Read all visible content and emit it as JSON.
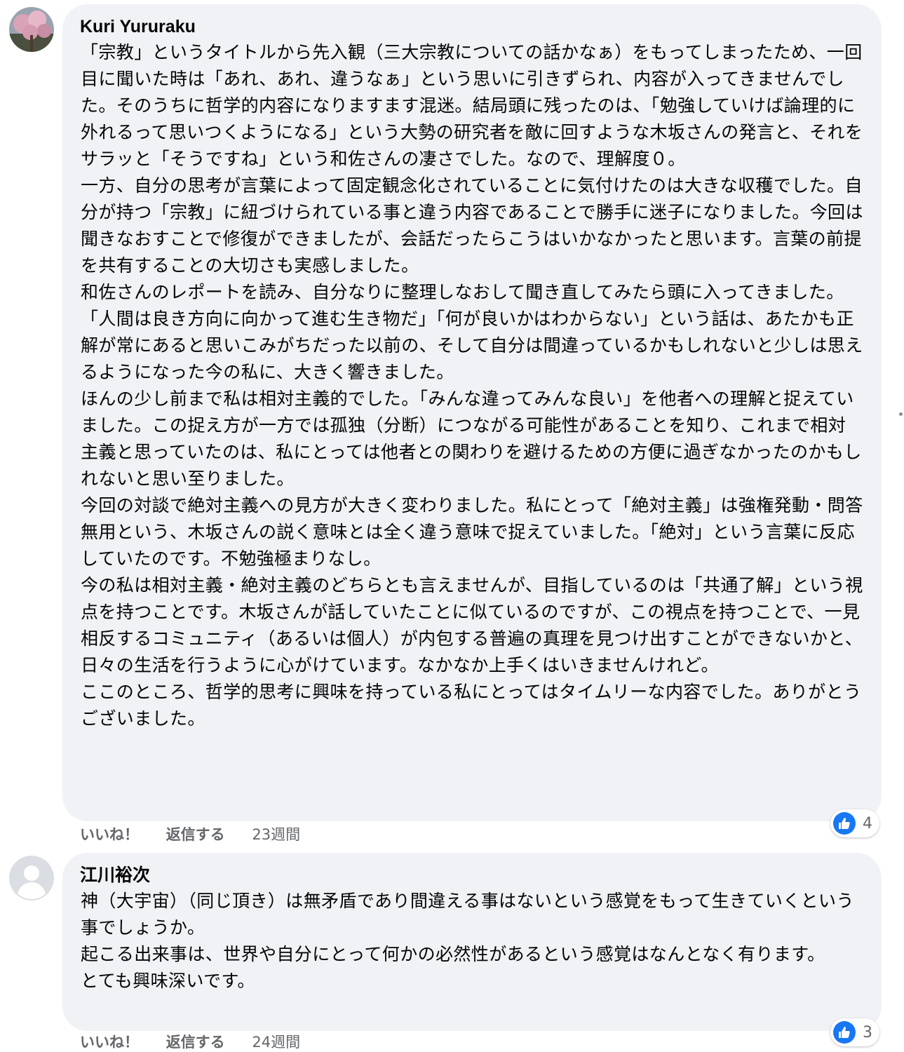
{
  "comments": [
    {
      "author": "Kuri Yururaku",
      "paragraphs": [
        "「宗教」というタイトルから先入観（三大宗教についての話かなぁ）をもってしまったため、一回目に聞いた時は「あれ、あれ、違うなぁ」という思いに引きずられ、内容が入ってきませんでした。そのうちに哲学的内容になりますます混迷。結局頭に残ったのは、「勉強していけば論理的に外れるって思いつくようになる」という大勢の研究者を敵に回すような木坂さんの発言と、それをサラッと「そうですね」という和佐さんの凄さでした。なので、理解度０。",
        "一方、自分の思考が言葉によって固定観念化されていることに気付けたのは大きな収穫でした。自分が持つ「宗教」に紐づけられている事と違う内容であることで勝手に迷子になりました。今回は聞きなおすことで修復ができましたが、会話だったらこうはいかなかったと思います。言葉の前提を共有することの大切さも実感しました。",
        "和佐さんのレポートを読み、自分なりに整理しなおして聞き直してみたら頭に入ってきました。",
        "「人間は良き方向に向かって進む生き物だ」「何が良いかはわからない」という話は、あたかも正解が常にあると思いこみがちだった以前の、そして自分は間違っているかもしれないと少しは思えるようになった今の私に、大きく響きました。",
        "ほんの少し前まで私は相対主義的でした。「みんな違ってみんな良い」を他者への理解と捉えていました。この捉え方が一方では孤独（分断）につながる可能性があることを知り、これまで相対主義と思っていたのは、私にとっては他者との関わりを避けるための方便に過ぎなかったのかもしれないと思い至りました。",
        "今回の対談で絶対主義への見方が大きく変わりました。私にとって「絶対主義」は強権発動・問答無用という、木坂さんの説く意味とは全く違う意味で捉えていました。「絶対」という言葉に反応していたのです。不勉強極まりなし。",
        "今の私は相対主義・絶対主義のどちらとも言えませんが、目指しているのは「共通了解」という視点を持つことです。木坂さんが話していたことに似ているのですが、この視点を持つことで、一見相反するコミュニティ（あるいは個人）が内包する普遍の真理を見つけ出すことができないかと、日々の生活を行うように心がけています。なかなか上手くはいきませんけれど。",
        "ここのところ、哲学的思考に興味を持っている私にとってはタイムリーな内容でした。ありがとうございました。"
      ],
      "like_label": "いいね！",
      "reply_label": "返信する",
      "time": "23週間",
      "reaction_count": "4",
      "avatar": "cherry-blossom-photo"
    },
    {
      "author": "江川裕次",
      "paragraphs": [
        "神（大宇宙）（同じ頂き）は無矛盾であり間違える事はないという感覚をもって生きていくという事でしょうか。",
        "起こる出来事は、世界や自分にとって何かの必然性があるという感覚はなんとなく有ります。",
        "とても興味深いです。"
      ],
      "like_label": "いいね！",
      "reply_label": "返信する",
      "time": "24週間",
      "reaction_count": "3",
      "avatar": "default-user-avatar"
    }
  ],
  "colors": {
    "bubble_bg": "#f0f2f5",
    "text": "#050505",
    "secondary_text": "#65676b",
    "like_blue": "#1877f2"
  }
}
